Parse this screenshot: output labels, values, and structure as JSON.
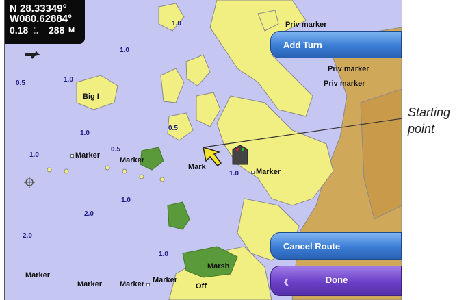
{
  "gps": {
    "latitude": "N 28.33349°",
    "longitude": "W080.62884°",
    "distance": "0.18",
    "distance_unit": "n m",
    "heading": "288",
    "heading_unit": "M"
  },
  "buttons": {
    "add_turn": "Add Turn",
    "cancel_route": "Cancel Route",
    "done": "Done"
  },
  "callout": {
    "line1": "Starting",
    "line2": "point"
  },
  "map_labels": {
    "big_i": "Big I",
    "marsh": "Marsh",
    "priv_marker_1": "Priv marker",
    "priv_marker_2": "Priv marker",
    "priv_marker_3": "Priv marker",
    "marker_1": "Marker",
    "marker_2": "Marker",
    "marker_3": "Mark",
    "marker_4": "Marker",
    "marker_5": "Marker",
    "marker_6": "Marker",
    "marker_7": "Marker",
    "marker_8": "Marker",
    "off": "Off"
  },
  "depths": {
    "d1": "1.0",
    "d2": "1.0",
    "d3": "1.0",
    "d4": "0.5",
    "d5": "1.0",
    "d6": "0.5",
    "d7": "1.0",
    "d8": "0.5",
    "d9": "1.0",
    "d10": "1.0",
    "d11": "2.0",
    "d12": "2.0",
    "d13": "1.0"
  },
  "colors": {
    "water": "#c6c6f2",
    "land": "#f2ef82",
    "deep_land": "#d0a85a",
    "marsh": "#5b9a3a",
    "button_blue": "#3b7cd4",
    "button_purple": "#6a3fc6"
  },
  "icons": [
    "boat-icon",
    "pointer-arrow-icon",
    "plane-icon",
    "crosshair-icon",
    "back-arrow-icon"
  ]
}
